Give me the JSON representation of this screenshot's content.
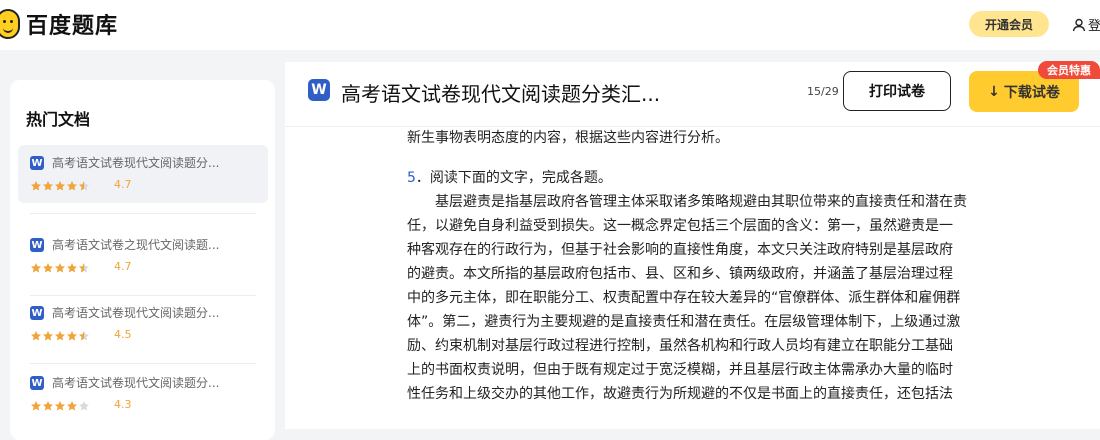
{
  "header": {
    "logo_text": "百度题库",
    "vip_label": "开通会员",
    "login_label": "登"
  },
  "sidebar": {
    "title": "热门文档",
    "items": [
      {
        "name": "高考语文试卷现代文阅读题分...",
        "rating": "4.7",
        "stars": 4.5,
        "active": true
      },
      {
        "name": "高考语文试卷之现代文阅读题...",
        "rating": "4.7",
        "stars": 4.5,
        "active": false
      },
      {
        "name": "高考语文试卷现代文阅读题分...",
        "rating": "4.5",
        "stars": 4.5,
        "active": false
      },
      {
        "name": "高考语文试卷现代文阅读题分...",
        "rating": "4.3",
        "stars": 4,
        "active": false
      }
    ]
  },
  "document": {
    "icon_letter": "W",
    "title": "高考语文试卷现代文阅读题分类汇...",
    "page_count": "15/29",
    "print_label": "打印试卷",
    "download_label": "下载试卷",
    "promo_label": "会员特惠",
    "lines": [
      "新生事物表明态度的内容，根据这些内容进行分析。",
      "",
      "5．阅读下面的文字，完成各题。",
      "　　基层避责是指基层政府各管理主体采取诸多策略规避由其职位带来的直接责任和潜在责",
      "任，以避免自身利益受到损失。这一概念界定包括三个层面的含义：第一，虽然避责是一",
      "种客观存在的行政行为，但基于社会影响的直接性角度，本文只关注政府特别是基层政府",
      "的避责。本文所指的基层政府包括市、县、区和乡、镇两级政府，并涵盖了基层治理过程",
      "中的多元主体，即在职能分工、权责配置中存在较大差异的“官僚群体、派生群体和雇佣群",
      "体”。第二，避责行为主要规避的是直接责任和潜在责任。在层级管理体制下，上级通过激",
      "励、约束机制对基层行政过程进行控制，虽然各机构和行政人员均有建立在职能分工基础",
      "上的书面权责说明，但由于既有规定过于宽泛模糊，并且基层行政主体需承办大量的临时",
      "性任务和上级交办的其他工作，故避责行为所规避的不仅是书面上的直接责任，还包括法"
    ]
  },
  "colors": {
    "accent_yellow": "#ffcb2f",
    "vip_yellow": "#ffe58f",
    "word_blue": "#2f5ec6",
    "star_orange": "#f0a43a",
    "promo_red": "#f04a3a"
  }
}
